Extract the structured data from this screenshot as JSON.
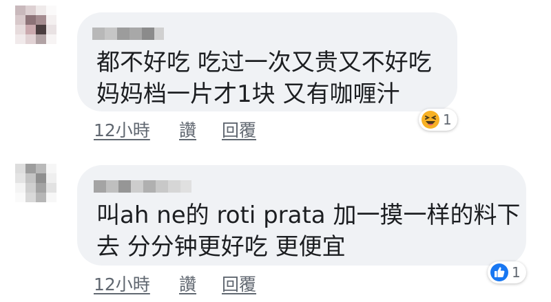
{
  "comments": [
    {
      "text": "都不好吃 吃过一次又贵又不好吃\n妈妈档一片才1块 又有咖喱汁",
      "time": "12小時",
      "like_label": "讚",
      "reply_label": "回覆",
      "reaction": {
        "icon": "haha-icon",
        "count": "1",
        "color": "#f7b125"
      }
    },
    {
      "text": "叫ah ne的 roti prata 加一摸一样的料下\n去 分分钟更好吃 更便宜",
      "time": "12小時",
      "like_label": "讚",
      "reply_label": "回覆",
      "reaction": {
        "icon": "like-icon",
        "count": "1",
        "color": "#1877f2"
      }
    }
  ]
}
